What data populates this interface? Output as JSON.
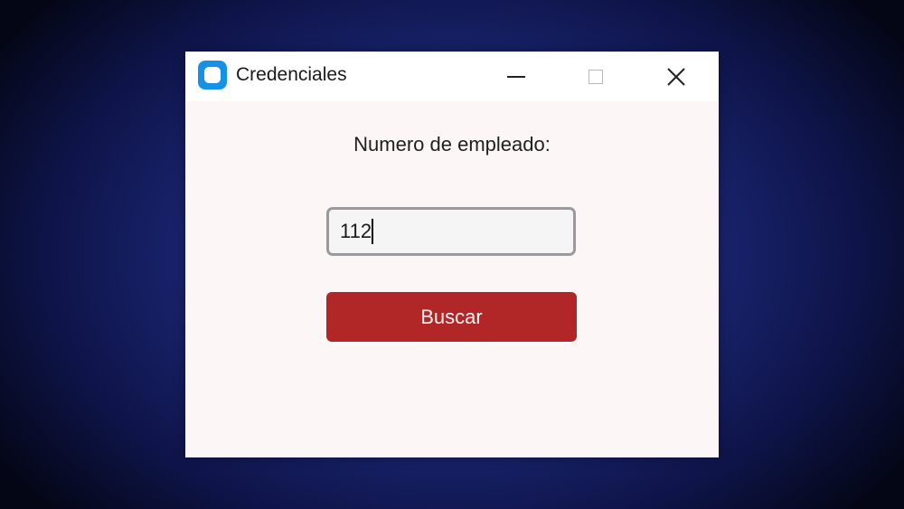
{
  "window": {
    "title": "Credenciales",
    "app_icon": "app-icon",
    "controls": {
      "minimize_icon": "minimize-icon",
      "maximize_icon": "maximize-icon",
      "close_icon": "close-icon"
    }
  },
  "form": {
    "label": "Numero de empleado:",
    "employee_number_value": "112",
    "search_button_label": "Buscar"
  },
  "colors": {
    "button_bg": "#b12627",
    "window_bg": "#fcf7f6",
    "app_icon_blue": "#1591e8"
  }
}
